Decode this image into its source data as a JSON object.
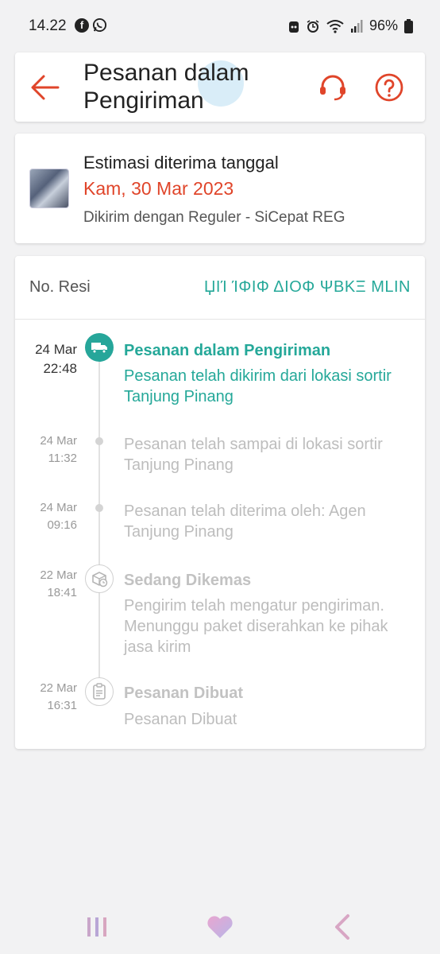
{
  "status_bar": {
    "time": "14.22",
    "battery": "96%",
    "icons": [
      "facebook-icon",
      "whatsapp-icon",
      "android-icon",
      "alarm-icon",
      "wifi-icon",
      "signal-icon",
      "battery-icon"
    ]
  },
  "header": {
    "title": "Pesanan dalam Pengiriman",
    "icons": [
      "back-arrow-icon",
      "headset-icon",
      "question-icon"
    ]
  },
  "estimate": {
    "label": "Estimasi diterima tanggal",
    "date": "Kam, 30 Mar 2023",
    "shipping": "Dikirim dengan Reguler - SiCepat REG"
  },
  "tracking": {
    "resi_label": "No. Resi",
    "resi_value": "ЏΙΊ ΊΦΙΦ ΔΙΟΦ ΨΒΚΞ ΜLIN",
    "events": [
      {
        "date": "24 Mar",
        "time": "22:48",
        "title": "Pesanan dalam Pengiriman",
        "desc": "Pesanan telah dikirim dari lokasi sortir Tanjung Pinang",
        "icon": "truck-icon",
        "active": true
      },
      {
        "date": "24 Mar",
        "time": "11:32",
        "title": "",
        "desc": "Pesanan telah sampai di lokasi sortir Tanjung Pinang",
        "icon": "dot",
        "active": false
      },
      {
        "date": "24 Mar",
        "time": "09:16",
        "title": "",
        "desc": "Pesanan telah diterima oleh: Agen Tanjung Pinang",
        "icon": "dot",
        "active": false
      },
      {
        "date": "22 Mar",
        "time": "18:41",
        "title": "Sedang Dikemas",
        "desc": "Pengirim telah mengatur pengiriman. Menunggu paket diserahkan ke pihak jasa kirim",
        "icon": "package-clock-icon",
        "active": false
      },
      {
        "date": "22 Mar",
        "time": "16:31",
        "title": "Pesanan Dibuat",
        "desc": "Pesanan Dibuat",
        "icon": "clipboard-icon",
        "active": false
      }
    ]
  },
  "nav": {
    "icons": [
      "recent-apps-icon",
      "home-heart-icon",
      "back-icon"
    ]
  },
  "colors": {
    "accent": "#e0452a",
    "teal": "#25a899",
    "muted": "#bdbdbd"
  }
}
